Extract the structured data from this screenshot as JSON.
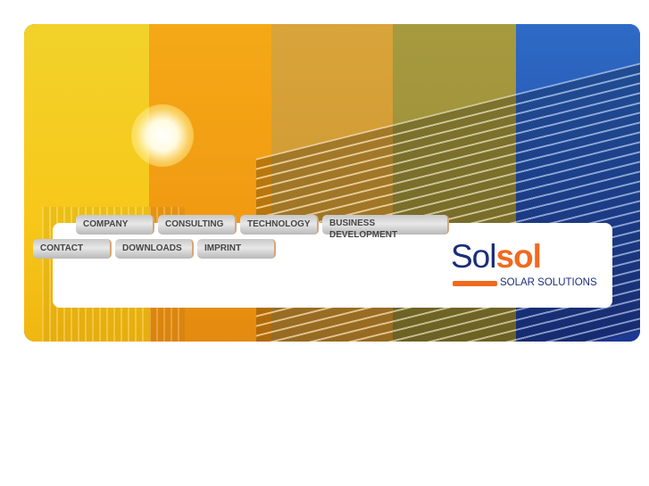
{
  "nav": {
    "company": "COMPANY",
    "consulting": "CONSULTING",
    "technology": "TECHNOLOGY",
    "business_line1": "BUSINESS",
    "business_line2": "DEVELOPMENT",
    "contact": "CONTACT",
    "downloads": "DOWNLOADS",
    "imprint": "IMPRINT"
  },
  "logo": {
    "part1": "Sol",
    "part2": "sol",
    "tagline": "SOLAR SOLUTIONS"
  },
  "colors": {
    "brand_orange": "#f06a1e",
    "brand_blue": "#1b2d7a"
  }
}
